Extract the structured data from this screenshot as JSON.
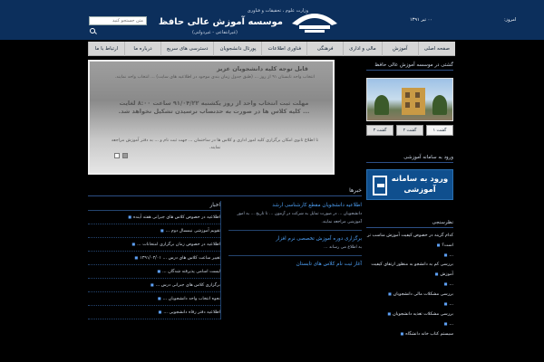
{
  "header": {
    "date_label": "امروز:",
    "date_value": "۰۰ تیر ۱۳۹۱",
    "ministry": "وزارت علوم ، تحقیقات و فناوری",
    "title": "موسسه آموزش عالی حافظ",
    "subtitle": "(غیرانتفاعی - غیردولتی)",
    "search_placeholder": "متن جستجو کنید"
  },
  "nav": {
    "items": [
      "صفحه اصلی",
      "آموزش",
      "مالی و اداری",
      "فرهنگی",
      "فناوری اطلاعات",
      "پورتال دانشجویان",
      "دسترسی های سریع",
      "درباره ما",
      "ارتباط با ما"
    ]
  },
  "slider": {
    "title": "قابل توجه کلیه دانشجویان عزیز",
    "paragraph1": "انتخاب واحد تابستان ۹۱ از روز ... (طبق جدول زمان بندی موجود در اطلاعیه های سایت) ... انتخاب واحد نمایند.",
    "notice": "مهلت ثبت انتخاب واحد از روز یکشنبه ۹۱/۰۴/۲۲ ساعت ۸:۰۰ لغایت ... کلیه کلاس ها در صورت به حدنصاب نرسیدن تشکیل نخواهد شد.",
    "paragraph2": "تا اطلاع ثانوی امکان برگزاری کلیه امور اداری و کلاس ها در ساختمان ... جهت ثبت نام و ... به دفتر آموزش مراجعه نمایند."
  },
  "sidebar": {
    "campus_heading": "گشتی در موسسه آموزش عالی حافظ",
    "tabs": [
      "گشت ۱",
      "گشت ۲",
      "گشت ۳"
    ],
    "edu_heading": "ورود به سامانه آموزشی",
    "login_text": "ورود به سامانه آموزشی",
    "categories_heading": "نظرسنجی",
    "categories": [
      "کدام گزینه در خصوص کیفیت آموزش مناسب تر است؟",
      "...",
      "بررسی کم به دانشجو به منظور ارتقای کیفیت آموزش",
      "...",
      "بررسی مشکلات مالی دانشجویان",
      "...",
      "بررسی مشکلات تغذیه دانشجویان",
      "...",
      "سیستم کتاب خانه دانشگاه"
    ]
  },
  "section": {
    "heading": "خبرها",
    "news": [
      {
        "title": "اطلاعیه دانشجویان مقطع کارشناسی ارشد",
        "body": "دانشجویان ... در صورت تمایل به شرکت در آزمون ... تا تاریخ ... به امور آموزشی مراجعه نمایند."
      },
      {
        "title": "برگزاری دوره آموزش تخصصی نرم افزار",
        "body": "به اطلاع می رساند ..."
      },
      {
        "title": "آغاز ثبت نام کلاس های تابستان",
        "body": ""
      }
    ],
    "left_heading": "اخبار",
    "left_items": [
      "اطلاعیه در خصوص کلاس های جبرانی هفته آینده",
      "تقویم آموزشی نیمسال دوم ...",
      "اطلاعیه در خصوص زمان برگزاری امتحانات ...",
      "تغییر ساعت کلاس های درس ... ۱۳۹۱/۰۴/۰۱",
      "لیست اسامی پذیرفته شدگان ...",
      "برگزاری کلاس های جبرانی درس ...",
      "نحوه انتخاب واحد دانشجویان ...",
      "اطلاعیه دفتر رفاه دانشجویی ..."
    ]
  }
}
